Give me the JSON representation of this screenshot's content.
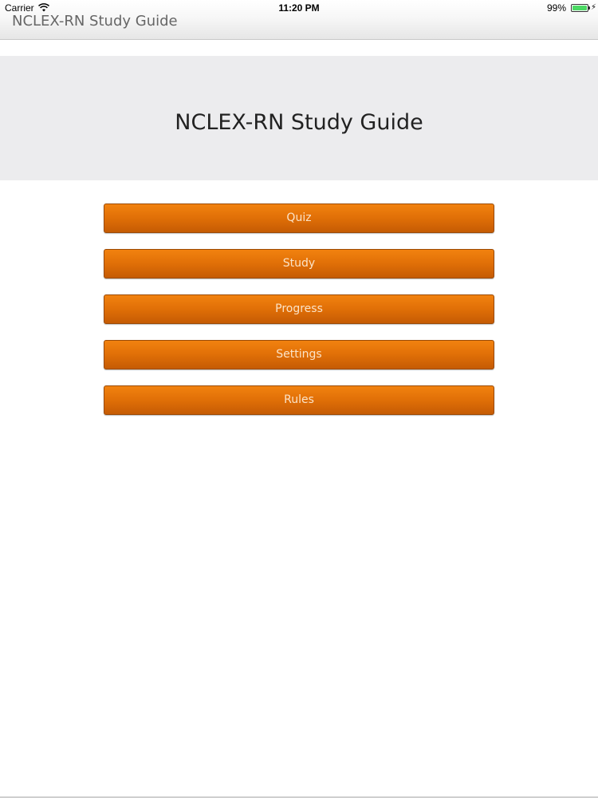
{
  "status_bar": {
    "carrier": "Carrier",
    "time": "11:20 PM",
    "battery": "99%",
    "battery_color": "#4cd964"
  },
  "nav": {
    "title": "NCLEX-RN Study Guide"
  },
  "banner": {
    "title": "NCLEX-RN Study Guide"
  },
  "menu": {
    "items": [
      {
        "label": "Quiz"
      },
      {
        "label": "Study"
      },
      {
        "label": "Progress"
      },
      {
        "label": "Settings"
      },
      {
        "label": "Rules"
      }
    ]
  },
  "colors": {
    "button_orange": "#e06f07",
    "banner_bg": "#ececee"
  }
}
